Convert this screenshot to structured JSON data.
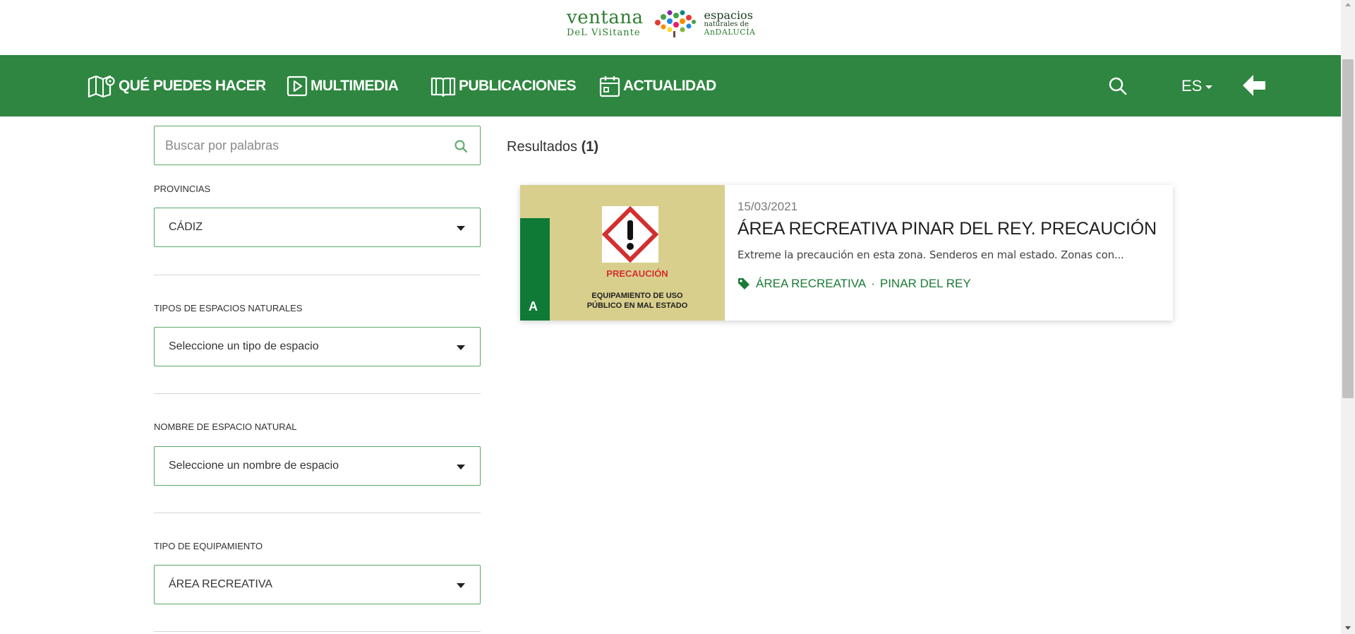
{
  "logo": {
    "line1": "ventana",
    "line2": "DeL ViSitante",
    "right1": "espacios",
    "right2": "naturales de",
    "right3": "AnDALUCÍA"
  },
  "nav": {
    "items": [
      {
        "label": "QUÉ PUEDES HACER",
        "icon": "map-pin-icon"
      },
      {
        "label": "MULTIMEDIA",
        "icon": "play-icon"
      },
      {
        "label": "PUBLICACIONES",
        "icon": "book-icon"
      },
      {
        "label": "ACTUALIDAD",
        "icon": "calendar-icon"
      }
    ],
    "search_icon": "search-icon",
    "language": "ES",
    "back_icon": "back-arrow-icon"
  },
  "colors": {
    "nav_green": "#2e8640",
    "accent_green": "#1b7a35",
    "border_green": "#5aa869"
  },
  "sidebar": {
    "search_placeholder": "Buscar por palabras",
    "filters": [
      {
        "label": "PROVINCIAS",
        "value": "CÁDIZ"
      },
      {
        "label": "TIPOS DE ESPACIOS NATURALES",
        "value": "Seleccione un tipo de espacio"
      },
      {
        "label": "NOMBRE DE ESPACIO NATURAL",
        "value": "Seleccione un nombre de espacio"
      },
      {
        "label": "TIPO DE EQUIPAMIENTO",
        "value": "ÁREA RECREATIVA"
      }
    ]
  },
  "results": {
    "label": "Resultados",
    "count": "(1)",
    "items": [
      {
        "date": "15/03/2021",
        "title": "ÁREA RECREATIVA PINAR DEL REY. PRECAUCIÓN",
        "description": "Extreme la precaución en esta zona. Senderos en mal estado. Zonas con...",
        "tags": [
          "ÁREA RECREATIVA",
          "PINAR DEL REY"
        ],
        "tag_separator": "·",
        "image": {
          "heading": "PRECAUCIÓN",
          "line1": "EQUIPAMIENTO DE USO",
          "line2": "PÚBLICO EN MAL ESTADO",
          "logo_letter": "A"
        }
      }
    ]
  }
}
